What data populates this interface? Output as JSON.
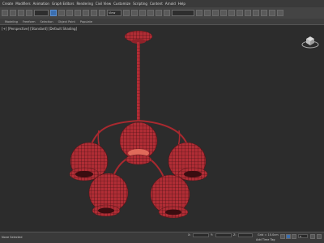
{
  "menu": [
    "Create",
    "Modifiers",
    "Animation",
    "Graph Editors",
    "Rendering",
    "Civil View",
    "Customize",
    "Scripting",
    "Content",
    "Arnold",
    "Help"
  ],
  "ribbon": [
    "Modeling",
    "Freeform",
    "Selection",
    "Object Paint",
    "Populate"
  ],
  "toolbar": {
    "view_select": "View"
  },
  "viewport": {
    "label": "[+] [Perspective] [Standard] [Default Shading]"
  },
  "status": {
    "left": "None Selected",
    "x": "X:",
    "y": "Y:",
    "z": "Z:",
    "grid": "Grid = 10.0cm",
    "addtime": "Add Time Tag",
    "frame": "0"
  },
  "colors": {
    "model": "#b02d35",
    "wire": "#3a0d10",
    "bg": "#2c2c2c"
  }
}
